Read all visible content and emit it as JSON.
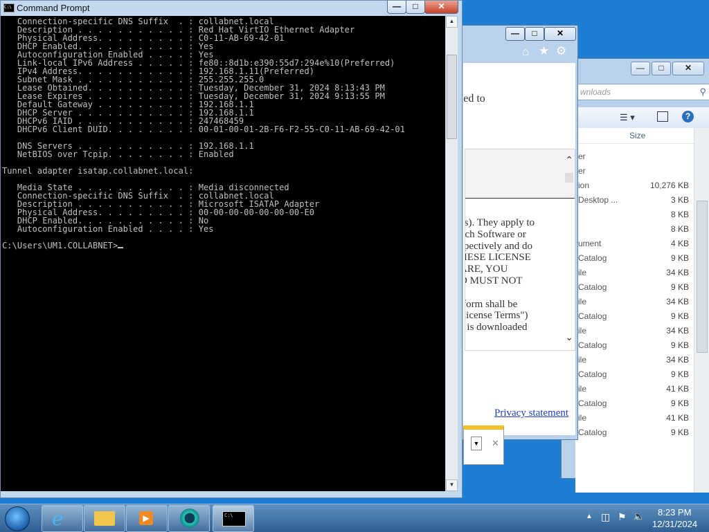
{
  "cmd": {
    "title": "Command Prompt",
    "lines": [
      "   Connection-specific DNS Suffix  . : collabnet.local",
      "   Description . . . . . . . . . . . : Red Hat VirtIO Ethernet Adapter",
      "   Physical Address. . . . . . . . . : C0-11-AB-69-42-01",
      "   DHCP Enabled. . . . . . . . . . . : Yes",
      "   Autoconfiguration Enabled . . . . : Yes",
      "   Link-local IPv6 Address . . . . . : fe80::8d1b:e390:55d7:294e%10(Preferred)",
      "   IPv4 Address. . . . . . . . . . . : 192.168.1.11(Preferred)",
      "   Subnet Mask . . . . . . . . . . . : 255.255.255.0",
      "   Lease Obtained. . . . . . . . . . : Tuesday, December 31, 2024 8:13:43 PM",
      "   Lease Expires . . . . . . . . . . : Tuesday, December 31, 2024 9:13:55 PM",
      "   Default Gateway . . . . . . . . . : 192.168.1.1",
      "   DHCP Server . . . . . . . . . . . : 192.168.1.1",
      "   DHCPv6 IAID . . . . . . . . . . . : 247468459",
      "   DHCPv6 Client DUID. . . . . . . . : 00-01-00-01-2B-F6-F2-55-C0-11-AB-69-42-01",
      "",
      "   DNS Servers . . . . . . . . . . . : 192.168.1.1",
      "   NetBIOS over Tcpip. . . . . . . . : Enabled",
      "",
      "Tunnel adapter isatap.collabnet.local:",
      "",
      "   Media State . . . . . . . . . . . : Media disconnected",
      "   Connection-specific DNS Suffix  . : collabnet.local",
      "   Description . . . . . . . . . . . : Microsoft ISATAP Adapter",
      "   Physical Address. . . . . . . . . : 00-00-00-00-00-00-00-E0",
      "   DHCP Enabled. . . . . . . . . . . : No",
      "   Autoconfiguration Enabled . . . . : Yes",
      "",
      "C:\\Users\\UM1.COLLABNET>"
    ]
  },
  "ie": {
    "header_fragment": "sed to",
    "license_lines": [
      "es). They apply to",
      "uch Software or",
      "spectively and do",
      "HESE LICENSE",
      "ARE, YOU",
      "D MUST NOT",
      "",
      "tform shall be",
      " License Terms\")",
      "e is downloaded"
    ],
    "privacy_link": "Privacy statement"
  },
  "explorer": {
    "search_placeholder": "wnloads",
    "size_header": "Size",
    "rows": [
      {
        "name": "er",
        "size": ""
      },
      {
        "name": "er",
        "size": ""
      },
      {
        "name": "ion",
        "size": "10,276 KB"
      },
      {
        "name": "Desktop ...",
        "size": "3 KB"
      },
      {
        "name": "",
        "size": "8 KB"
      },
      {
        "name": "",
        "size": "8 KB"
      },
      {
        "name": "ument",
        "size": "4 KB"
      },
      {
        "name": "Catalog",
        "size": "9 KB"
      },
      {
        "name": "ile",
        "size": "34 KB"
      },
      {
        "name": "Catalog",
        "size": "9 KB"
      },
      {
        "name": "ile",
        "size": "34 KB"
      },
      {
        "name": "Catalog",
        "size": "9 KB"
      },
      {
        "name": "ile",
        "size": "34 KB"
      },
      {
        "name": "Catalog",
        "size": "9 KB"
      },
      {
        "name": "ile",
        "size": "34 KB"
      },
      {
        "name": "Catalog",
        "size": "9 KB"
      },
      {
        "name": "ile",
        "size": "41 KB"
      },
      {
        "name": "Catalog",
        "size": "9 KB"
      },
      {
        "name": "ile",
        "size": "41 KB"
      },
      {
        "name": "Catalog",
        "size": "9 KB"
      }
    ]
  },
  "taskbar": {
    "time": "8:23 PM",
    "date": "12/31/2024",
    "items": [
      "internet-explorer",
      "file-explorer",
      "media-player",
      "app-circle",
      "command-prompt"
    ]
  }
}
